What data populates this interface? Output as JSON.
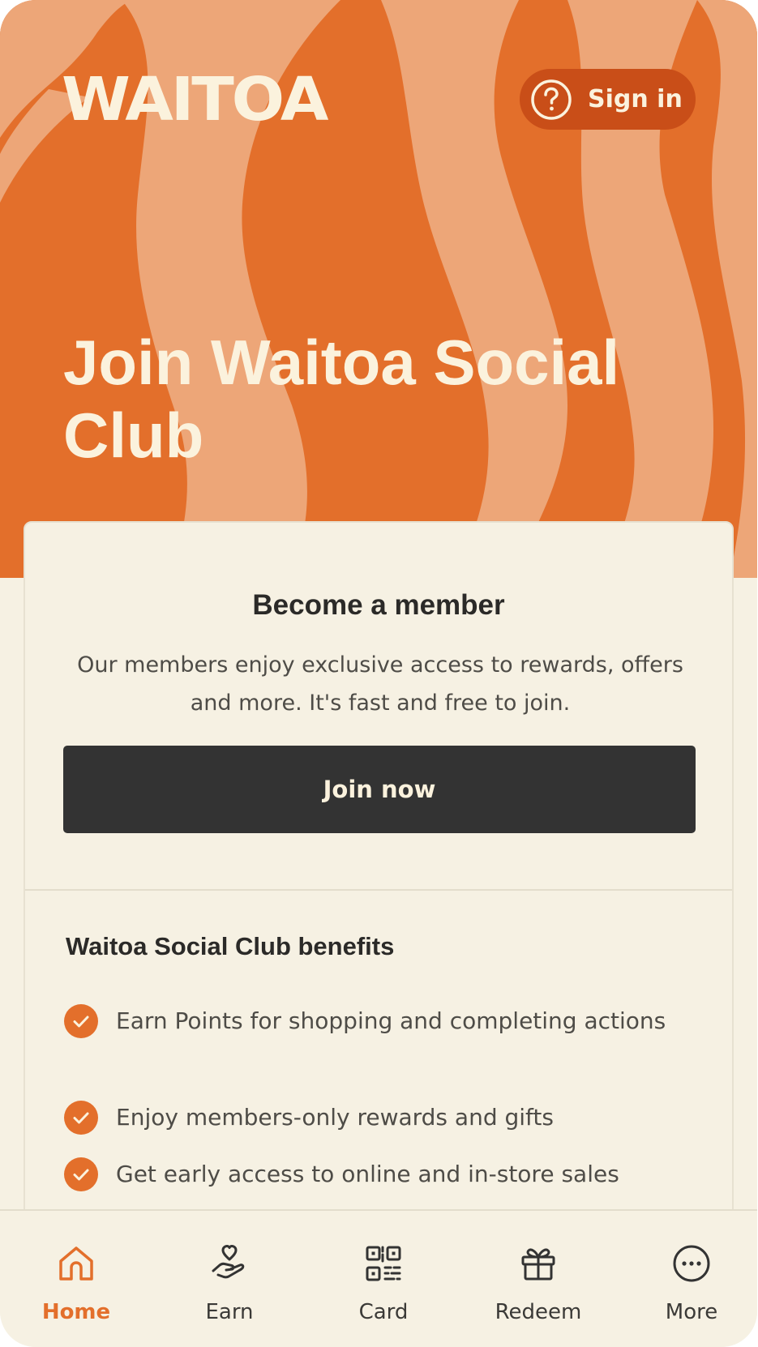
{
  "colors": {
    "brand_orange": "#e36f2b",
    "wave_light": "#eda678",
    "cream": "#f6f1e3",
    "dark_button": "#333333",
    "signin_bg": "#c94e18"
  },
  "header": {
    "logo": "WAITOA",
    "signin_label": "Sign in",
    "signin_icon": "question-circle-icon",
    "title": "Join Waitoa Social Club"
  },
  "membership": {
    "heading": "Become a member",
    "description": "Our members enjoy exclusive access to rewards, offers and more. It's fast and free to join.",
    "join_label": "Join now"
  },
  "benefits": {
    "title": "Waitoa Social Club benefits",
    "icon": "check-circle-icon",
    "items": [
      "Earn Points for shopping and completing actions",
      "Enjoy members-only rewards and gifts",
      "Get early access to online and in-store sales"
    ]
  },
  "tabs": [
    {
      "label": "Home",
      "icon": "home-icon",
      "active": true
    },
    {
      "label": "Earn",
      "icon": "hand-heart-icon",
      "active": false
    },
    {
      "label": "Card",
      "icon": "qr-code-icon",
      "active": false
    },
    {
      "label": "Redeem",
      "icon": "gift-icon",
      "active": false
    },
    {
      "label": "More",
      "icon": "more-icon",
      "active": false
    }
  ]
}
